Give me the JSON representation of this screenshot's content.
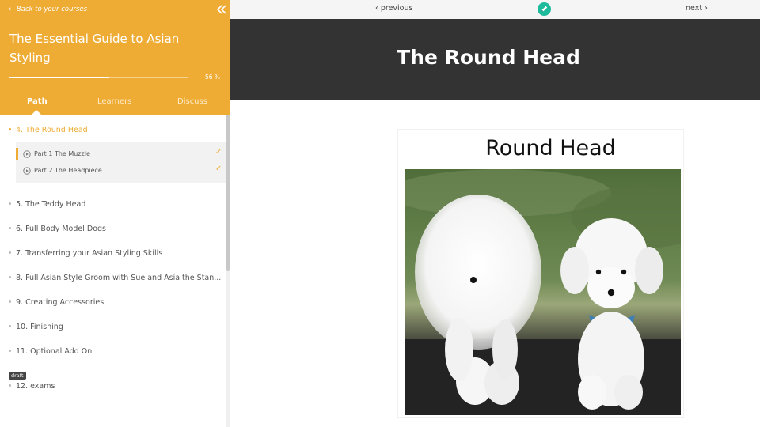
{
  "sidebar": {
    "back_link": "← Back to your courses",
    "course_title": "The Essential Guide to Asian Styling",
    "progress": {
      "percent": 56,
      "label": "56 %"
    },
    "tabs": [
      {
        "label": "Path",
        "active": true
      },
      {
        "label": "Learners",
        "active": false
      },
      {
        "label": "Discuss",
        "active": false
      }
    ],
    "modules": [
      {
        "label": "4. The Round Head",
        "active": true,
        "lessons": [
          {
            "label": "Part 1 The Muzzle",
            "completed": true,
            "current": true
          },
          {
            "label": "Part 2 The Headpiece",
            "completed": true,
            "current": false
          }
        ]
      },
      {
        "label": "5. The Teddy Head"
      },
      {
        "label": "6. Full Body Model Dogs"
      },
      {
        "label": "7. Transferring your Asian Styling Skills"
      },
      {
        "label": "8. Full Asian Style Groom with Sue and Asia the Stan..."
      },
      {
        "label": "9. Creating Accessories"
      },
      {
        "label": "10. Finishing"
      },
      {
        "label": "11. Optional Add On"
      },
      {
        "label": "12. exams",
        "badge": "draft"
      }
    ],
    "check_mark": "✓"
  },
  "topbar": {
    "previous_label": "‹ previous",
    "next_label": "next ›",
    "edit_icon": "pencil-icon"
  },
  "hero": {
    "title": "The Round Head"
  },
  "content": {
    "image_caption": "Round Head",
    "image_subject": "two white groomed poodle models"
  },
  "colors": {
    "accent": "#efac35",
    "hero_bg": "#333333",
    "edit_button": "#1cbb9b",
    "topbar_bg": "#f5f5f5"
  }
}
